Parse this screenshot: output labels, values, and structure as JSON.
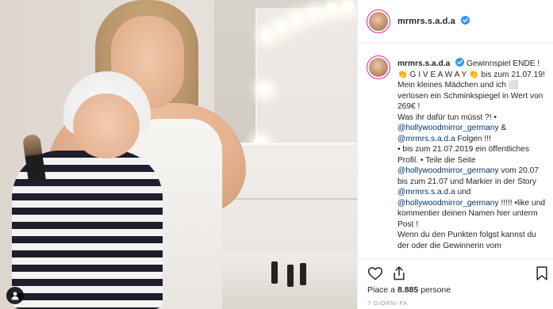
{
  "post": {
    "username": "mrmrs.s.a.d.a",
    "verified": true
  },
  "caption": {
    "username": "mrmrs.s.a.d.a",
    "lines": [
      {
        "text": "Gewinnspiel ENDE !"
      },
      {
        "text": "👏 G I V E A W A Y 👏 bis zum 21.07.19!"
      },
      {
        "text": "Mein kleines Mädchen und ich ⬜ verlosen ein Schminkspiegel in Wert von 269€ !"
      },
      {
        "text": "Was ihr dafür tun müsst ?! •"
      }
    ],
    "mention_1": "@hollywoodmirror_germany",
    "mention_1_after": "&",
    "mention_2": "@mrmrs.s.a.d.a",
    "mention_2_after": "Folgen !!!",
    "line_5": "• bis zum 21.07.2019 ein öffentliches Profil. • Teile die Seite",
    "mention_3": "@hollywoodmirror_germany",
    "mention_3_after": "vom 20.07 bis zum 21.07 und Markier in der Story",
    "mention_4": "@mrmrs.s.a.d.a",
    "mention_4_after": "und",
    "mention_5": "@hollywoodmirror_germany",
    "mention_5_after": "!!!!! •like und kommentier deinen Namen hier unterm Post !",
    "line_last": "Wenn du den Punkten folgst kannst du der oder die Gewinnerin vom"
  },
  "actions": {
    "like_icon": "heart-icon",
    "share_icon": "share-icon",
    "save_icon": "bookmark-icon"
  },
  "likes": {
    "prefix": "Piace a",
    "count": "8.885",
    "suffix": "persone"
  },
  "timestamp": "7 GIORNI FA",
  "colors": {
    "verified": "#3897f0",
    "mention": "#003569",
    "story_ring": "#d6249f"
  }
}
